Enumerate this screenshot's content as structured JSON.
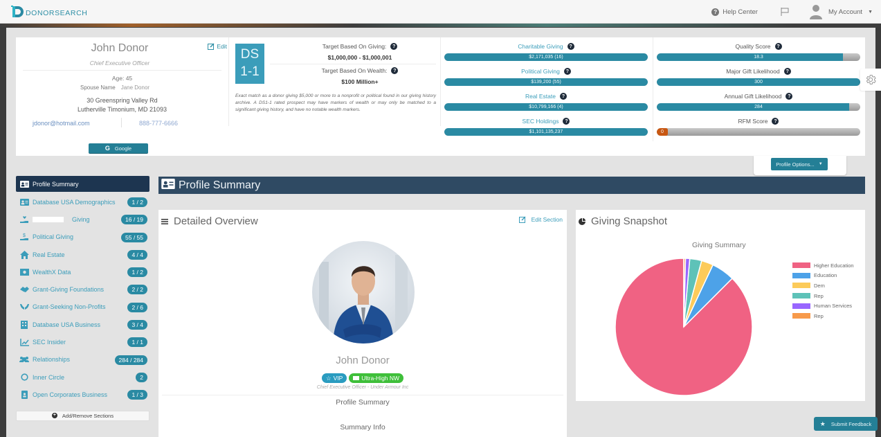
{
  "topnav": {
    "logo_text": "DONORSEARCH",
    "help_center": "Help Center",
    "my_account": "My Account"
  },
  "person": {
    "name": "John Donor",
    "title": "Chief Executive Officer",
    "edit_label": "Edit",
    "age": "Age: 45",
    "spouse_label": "Spouse Name",
    "spouse_name": "Jane Donor",
    "address_line1": "30 Greenspring Valley Rd",
    "address_line2": "Lutherville Timonium, MD 21093",
    "email": "jdonor@hotmail.com",
    "phone": "888-777-6666",
    "google_button": "Google"
  },
  "ds_rating": {
    "badge_line1": "DS",
    "badge_line2": "1-1",
    "target_giving_label": "Target Based On Giving:",
    "target_giving_value": "$1,000,000 - $1,000,001",
    "target_wealth_label": "Target Based On Wealth:",
    "target_wealth_value": "$100 Million+",
    "description": "Exact match as a donor giving $5,000 or more to a nonprofit or political found in our giving history archive. A DS1-1 rated prospect may have markers of wealth or may only be matched to a significant giving history, and have no notable wealth markers."
  },
  "wealth_bars": [
    {
      "label": "Charitable Giving",
      "value": "$2,171,035 (16)",
      "fill_pct": 100
    },
    {
      "label": "Political Giving",
      "value": "$139,200 (55)",
      "fill_pct": 100
    },
    {
      "label": "Real Estate",
      "value": "$10,799,166 (4)",
      "fill_pct": 100
    },
    {
      "label": "SEC Holdings",
      "value": "$1,101,135,237",
      "fill_pct": 100
    }
  ],
  "score_bars": [
    {
      "label": "Quality Score",
      "value": "18.3",
      "fill_pct": 91.5
    },
    {
      "label": "Major Gift Likelihood",
      "value": "300",
      "fill_pct": 100
    },
    {
      "label": "Annual Gift Likelihood",
      "value": "284",
      "fill_pct": 94.7
    },
    {
      "label": "RFM Score",
      "value": "0",
      "fill_pct": 0
    }
  ],
  "profile_options": "Profile Options...",
  "sidebar": {
    "items": [
      {
        "label": "Profile Summary",
        "badge": "",
        "icon": "id-card-icon"
      },
      {
        "label": "Database USA Demographics",
        "badge": "1 / 2",
        "icon": "id-card-icon"
      },
      {
        "label": "Giving",
        "badge": "16 / 19",
        "icon": "hand-heart-icon"
      },
      {
        "label": "Political Giving",
        "badge": "55 / 55",
        "icon": "hand-dollar-icon"
      },
      {
        "label": "Real Estate",
        "badge": "4 / 4",
        "icon": "home-icon"
      },
      {
        "label": "WealthX Data",
        "badge": "1 / 2",
        "icon": "money-icon"
      },
      {
        "label": "Grant-Giving Foundations",
        "badge": "2 / 2",
        "icon": "handshake-icon"
      },
      {
        "label": "Grant-Seeking Non-Profits",
        "badge": "2 / 6",
        "icon": "hands-icon"
      },
      {
        "label": "Database USA Business",
        "badge": "3 / 4",
        "icon": "building-icon"
      },
      {
        "label": "SEC Insider",
        "badge": "1 / 1",
        "icon": "chart-line-icon"
      },
      {
        "label": "Relationships",
        "badge": "284 / 284",
        "icon": "people-icon"
      },
      {
        "label": "Inner Circle",
        "badge": "2",
        "icon": "circle-icon"
      },
      {
        "label": "Open Corporates Business",
        "badge": "1 / 3",
        "icon": "badge-icon"
      }
    ],
    "add_remove": "Add/Remove Sections"
  },
  "section_header": "Profile Summary",
  "overview": {
    "title": "Detailed Overview",
    "edit_section": "Edit Section",
    "name": "John Donor",
    "badge_vip": "VIP",
    "badge_nw": "Ultra-High NW",
    "subtitle": "Chief Executive Officer - Under Armour Inc",
    "profile_summary": "Profile Summary",
    "summary_info": "Summary Info"
  },
  "giving_snapshot": {
    "title": "Giving Snapshot"
  },
  "chart_data": {
    "type": "pie",
    "title": "Giving Summary",
    "legend_position": "right",
    "categories": [
      "Higher Education",
      "Education",
      "Dem",
      "Rep",
      "Human Services",
      "Rep"
    ],
    "values": [
      87.5,
      5.5,
      2.8,
      2.8,
      1.0,
      0.4
    ],
    "colors": [
      "#f06283",
      "#4da2e8",
      "#fccb5a",
      "#5ec2b8",
      "#9966ff",
      "#f79a4b"
    ]
  },
  "feedback_button": "Submit Feedback",
  "colors": {
    "teal": "#2a8aa3",
    "navy": "#1d3550",
    "section_header": "#2f4a63",
    "vip": "#2a9cc0",
    "ultra_high_nw": "#3fbf3a",
    "rfm": "#c85712"
  }
}
